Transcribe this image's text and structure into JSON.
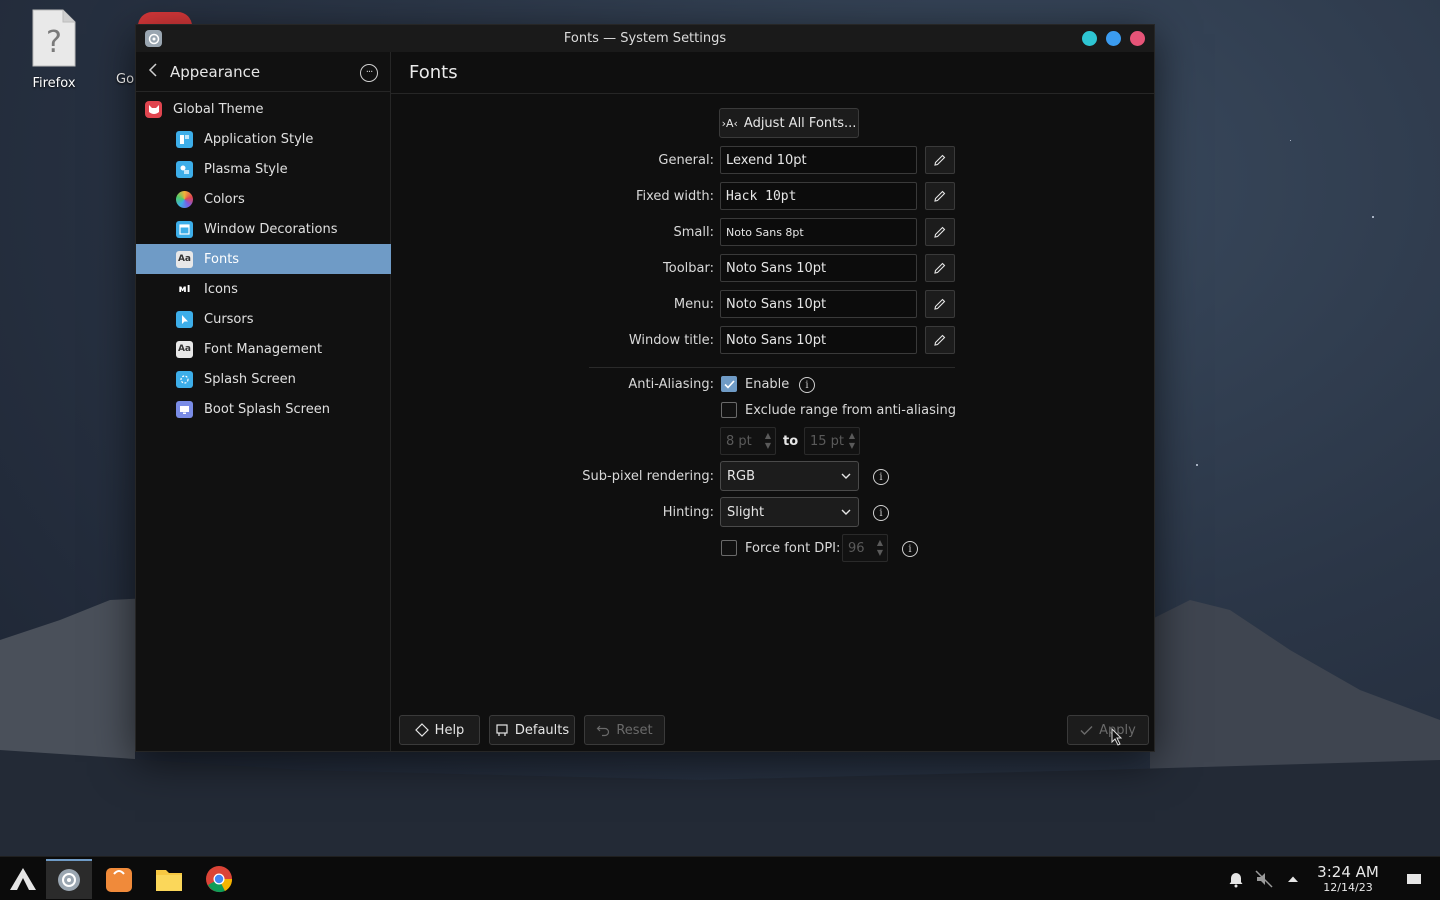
{
  "window": {
    "title": "Fonts — System Settings"
  },
  "desktop": {
    "icons": [
      {
        "label": "Firefox"
      },
      {
        "label": "Go"
      }
    ]
  },
  "sidebar": {
    "title": "Appearance",
    "items": [
      {
        "label": "Global Theme",
        "icon": "global-theme-icon",
        "color": "#e0454f"
      },
      {
        "label": "Application Style",
        "icon": "application-style-icon",
        "color": "#3daee9"
      },
      {
        "label": "Plasma Style",
        "icon": "plasma-style-icon",
        "color": "#3daee9"
      },
      {
        "label": "Colors",
        "icon": "colors-icon",
        "color": "#f0b23a"
      },
      {
        "label": "Window Decorations",
        "icon": "window-decorations-icon",
        "color": "#3daee9"
      },
      {
        "label": "Fonts",
        "icon": "fonts-icon",
        "color": "#e8e8e8"
      },
      {
        "label": "Icons",
        "icon": "icons-icon",
        "color": "#ffffff"
      },
      {
        "label": "Cursors",
        "icon": "cursors-icon",
        "color": "#3daee9"
      },
      {
        "label": "Font Management",
        "icon": "font-management-icon",
        "color": "#e8e8e8"
      },
      {
        "label": "Splash Screen",
        "icon": "splash-screen-icon",
        "color": "#3daee9"
      },
      {
        "label": "Boot Splash Screen",
        "icon": "boot-splash-screen-icon",
        "color": "#7a8ce6"
      }
    ],
    "selected": "Fonts"
  },
  "page": {
    "title": "Fonts",
    "adjust_all": "Adjust All Fonts...",
    "adjust_icon_text": "›A‹",
    "fonts": [
      {
        "label": "General:",
        "value": "Lexend 10pt"
      },
      {
        "label": "Fixed width:",
        "value": "Hack 10pt"
      },
      {
        "label": "Small:",
        "value": "Noto Sans 8pt"
      },
      {
        "label": "Toolbar:",
        "value": "Noto Sans 10pt"
      },
      {
        "label": "Menu:",
        "value": "Noto Sans 10pt"
      },
      {
        "label": "Window title:",
        "value": "Noto Sans 10pt"
      }
    ],
    "antialiasing": {
      "label": "Anti-Aliasing:",
      "enable_label": "Enable",
      "enabled": true,
      "exclude_label": "Exclude range from anti-aliasing",
      "exclude": false,
      "from": "8 pt",
      "to_label": "to",
      "to": "15 pt"
    },
    "subpixel": {
      "label": "Sub-pixel rendering:",
      "value": "RGB"
    },
    "hinting": {
      "label": "Hinting:",
      "value": "Slight"
    },
    "force_dpi": {
      "label": "Force font DPI:",
      "checked": false,
      "value": "96"
    },
    "info_glyph": "i"
  },
  "footer": {
    "help": "Help",
    "defaults": "Defaults",
    "reset": "Reset",
    "apply": "Apply"
  },
  "taskbar": {
    "apps": [
      "launcher-icon",
      "system-settings-icon",
      "software-store-icon",
      "files-icon",
      "chrome-icon"
    ],
    "time": "3:24 AM",
    "date": "12/14/23"
  },
  "colors": {
    "accent": "#6f9bc6",
    "minimize": "#2ec5d3",
    "maximize": "#3b9cf0",
    "close": "#e75478"
  }
}
